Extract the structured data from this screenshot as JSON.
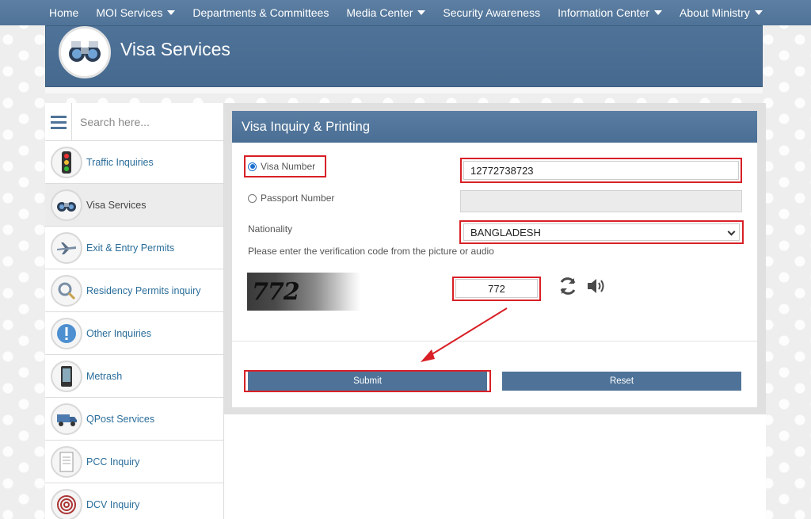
{
  "nav": {
    "items": [
      {
        "label": "Home",
        "dropdown": false
      },
      {
        "label": "MOI Services",
        "dropdown": true
      },
      {
        "label": "Departments & Committees",
        "dropdown": false
      },
      {
        "label": "Media Center",
        "dropdown": true
      },
      {
        "label": "Security Awareness",
        "dropdown": false
      },
      {
        "label": "Information Center",
        "dropdown": true
      },
      {
        "label": "About Ministry",
        "dropdown": true
      }
    ]
  },
  "banner": {
    "title": "Visa Services"
  },
  "sidebar": {
    "search_placeholder": "Search here...",
    "items": [
      {
        "label": "Traffic Inquiries",
        "icon": "traffic-light-icon"
      },
      {
        "label": "Visa Services",
        "icon": "binoculars-icon"
      },
      {
        "label": "Exit & Entry Permits",
        "icon": "airplane-icon"
      },
      {
        "label": "Residency Permits inquiry",
        "icon": "magnifier-icon"
      },
      {
        "label": "Other Inquiries",
        "icon": "exclamation-icon"
      },
      {
        "label": "Metrash",
        "icon": "phone-icon"
      },
      {
        "label": "QPost Services",
        "icon": "delivery-truck-icon"
      },
      {
        "label": "PCC Inquiry",
        "icon": "document-icon"
      },
      {
        "label": "DCV Inquiry",
        "icon": "fingerprint-icon"
      }
    ]
  },
  "form": {
    "header": "Visa Inquiry & Printing",
    "visa_number_label": "Visa Number",
    "visa_number_value": "12772738723",
    "passport_number_label": "Passport Number",
    "passport_number_value": "",
    "nationality_label": "Nationality",
    "nationality_value": "BANGLADESH",
    "verification_instruction": "Please enter the verification code from the picture or audio",
    "captcha_image_text": "772",
    "captcha_value": "772",
    "submit_label": "Submit",
    "reset_label": "Reset"
  },
  "colors": {
    "primary": "#4f7398",
    "highlight": "#d82026",
    "link": "#2a6d9a"
  }
}
